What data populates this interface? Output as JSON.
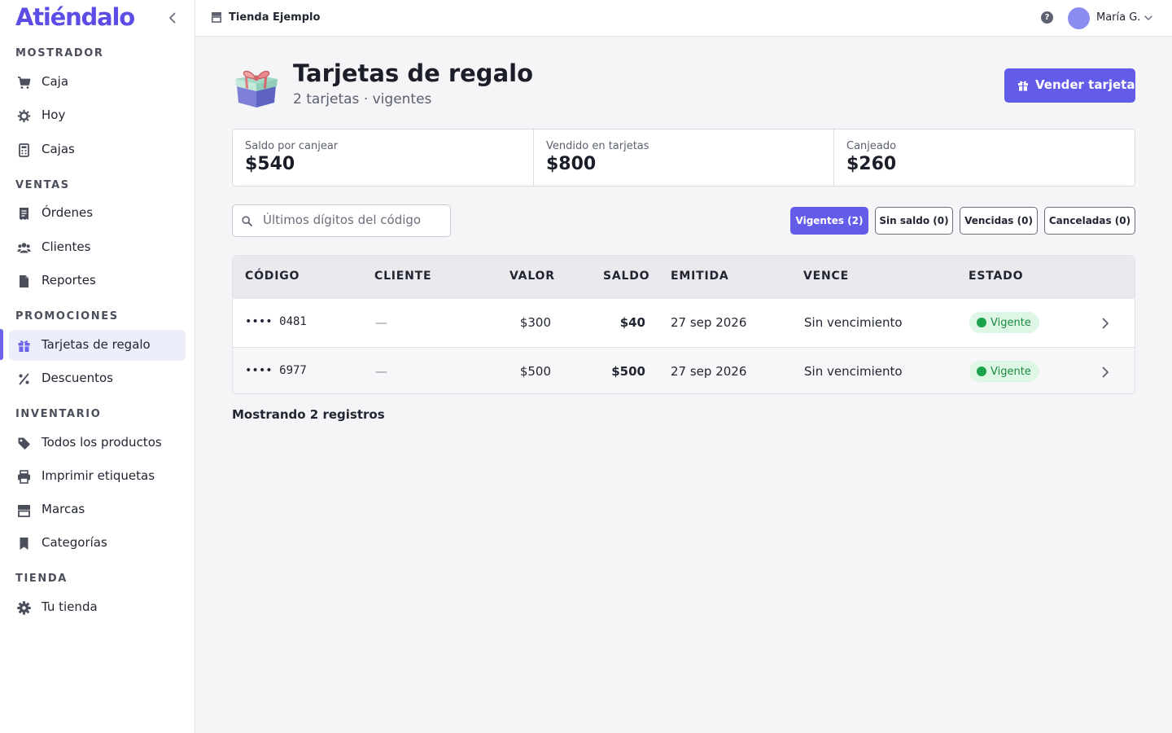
{
  "app": {
    "brand": "Atiéndalo"
  },
  "sidebar": {
    "sections": [
      {
        "title": "MOSTRADOR",
        "items": [
          {
            "label": "Caja",
            "icon": "cart-icon"
          },
          {
            "label": "Hoy",
            "icon": "sun-gear-icon"
          },
          {
            "label": "Cajas",
            "icon": "calculator-icon"
          }
        ]
      },
      {
        "title": "VENTAS",
        "items": [
          {
            "label": "Órdenes",
            "icon": "receipt-icon"
          },
          {
            "label": "Clientes",
            "icon": "users-icon"
          },
          {
            "label": "Reportes",
            "icon": "document-icon"
          }
        ]
      },
      {
        "title": "PROMOCIONES",
        "items": [
          {
            "label": "Tarjetas de regalo",
            "icon": "gift-icon",
            "active": true
          },
          {
            "label": "Descuentos",
            "icon": "percent-icon"
          }
        ]
      },
      {
        "title": "INVENTARIO",
        "items": [
          {
            "label": "Todos los productos",
            "icon": "tag-icon"
          },
          {
            "label": "Imprimir etiquetas",
            "icon": "printer-icon"
          },
          {
            "label": "Marcas",
            "icon": "store-icon"
          },
          {
            "label": "Categorías",
            "icon": "bookmark-icon"
          }
        ]
      },
      {
        "title": "TIENDA",
        "items": [
          {
            "label": "Tu tienda",
            "icon": "gear-icon"
          }
        ]
      }
    ]
  },
  "topbar": {
    "store_name": "Tienda Ejemplo",
    "help_label": "?",
    "user_name": "María G."
  },
  "header": {
    "title": "Tarjetas de regalo",
    "subtitle": "2 tarjetas · vigentes",
    "sell_button": "Vender tarjeta"
  },
  "stats": [
    {
      "label": "Saldo por canjear",
      "value": "$540"
    },
    {
      "label": "Vendido en tarjetas",
      "value": "$800"
    },
    {
      "label": "Canjeado",
      "value": "$260"
    }
  ],
  "search": {
    "placeholder": "Últimos dígitos del código",
    "value": ""
  },
  "filters": [
    {
      "label": "Vigentes (2)",
      "active": true
    },
    {
      "label": "Sin saldo (0)",
      "active": false
    },
    {
      "label": "Vencidas (0)",
      "active": false
    },
    {
      "label": "Canceladas (0)",
      "active": false
    }
  ],
  "table": {
    "columns": [
      "CÓDIGO",
      "CLIENTE",
      "VALOR",
      "SALDO",
      "EMITIDA",
      "VENCE",
      "ESTADO"
    ],
    "rows": [
      {
        "code": "•••• 0481",
        "client": "—",
        "value": "$300",
        "balance": "$40",
        "issued": "27 sep 2026",
        "expires": "Sin vencimiento",
        "status": "Vigente"
      },
      {
        "code": "•••• 6977",
        "client": "—",
        "value": "$500",
        "balance": "$500",
        "issued": "27 sep 2026",
        "expires": "Sin vencimiento",
        "status": "Vigente"
      }
    ]
  },
  "footer": {
    "records": "Mostrando 2 registros"
  },
  "colors": {
    "accent": "#635ce8",
    "brand": "#5b4de6",
    "status_ok": "#1aa34a"
  }
}
